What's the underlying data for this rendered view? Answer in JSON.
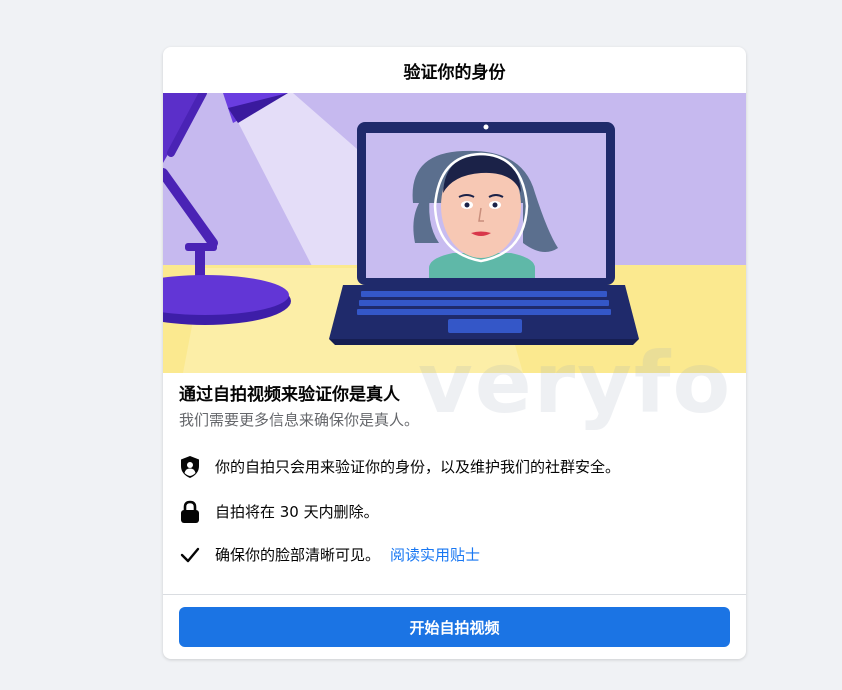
{
  "dialog": {
    "title": "验证你的身份"
  },
  "content": {
    "headline": "通过自拍视频来验证你是真人",
    "subhead": "我们需要更多信息来确保你是真人。",
    "bullets": [
      {
        "icon": "shield-user-icon",
        "text": "你的自拍只会用来验证你的身份，以及维护我们的社群安全。"
      },
      {
        "icon": "lock-icon",
        "text": "自拍将在 30 天内删除。"
      },
      {
        "icon": "checkmark-icon",
        "text": "确保你的脸部清晰可见。",
        "link": "阅读实用贴士"
      }
    ]
  },
  "footer": {
    "primary_button": "开始自拍视频"
  },
  "watermark": "veryfo",
  "colors": {
    "background": "#f0f2f5",
    "accent": "#1b74e4",
    "link": "#1877f2",
    "illustration_purple": "#c5b8ef",
    "illustration_yellow": "#fce98f",
    "laptop_navy": "#1f2a6b"
  }
}
